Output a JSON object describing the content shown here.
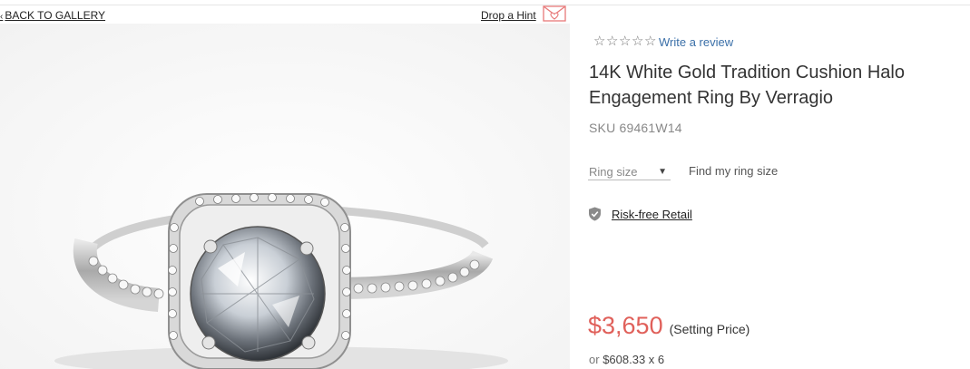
{
  "nav": {
    "back_chevron": "‹",
    "back_label": "BACK TO GALLERY",
    "hint_label": "Drop a Hint",
    "hint_icon": "envelope-heart-icon"
  },
  "product": {
    "rating_icon": "star-outline-icon",
    "star_count": 5,
    "review_link": "Write a review",
    "title": "14K White Gold Tradition Cushion Halo Engagement Ring By Verragio",
    "sku": "SKU 69461W14",
    "ring_size_label": "Ring size",
    "find_size_link": "Find my ring size",
    "risk_free_label": "Risk-free Retail",
    "risk_free_icon": "shield-check-icon",
    "price": "$3,650",
    "price_note": "(Setting Price)",
    "installment_prefix": "or",
    "installment_value": "$608.33 x 6"
  },
  "colors": {
    "price": "#e0605a",
    "link": "#3a6fa8",
    "hint_icon": "#e87a7a"
  },
  "image": {
    "subject": "ring-image"
  }
}
